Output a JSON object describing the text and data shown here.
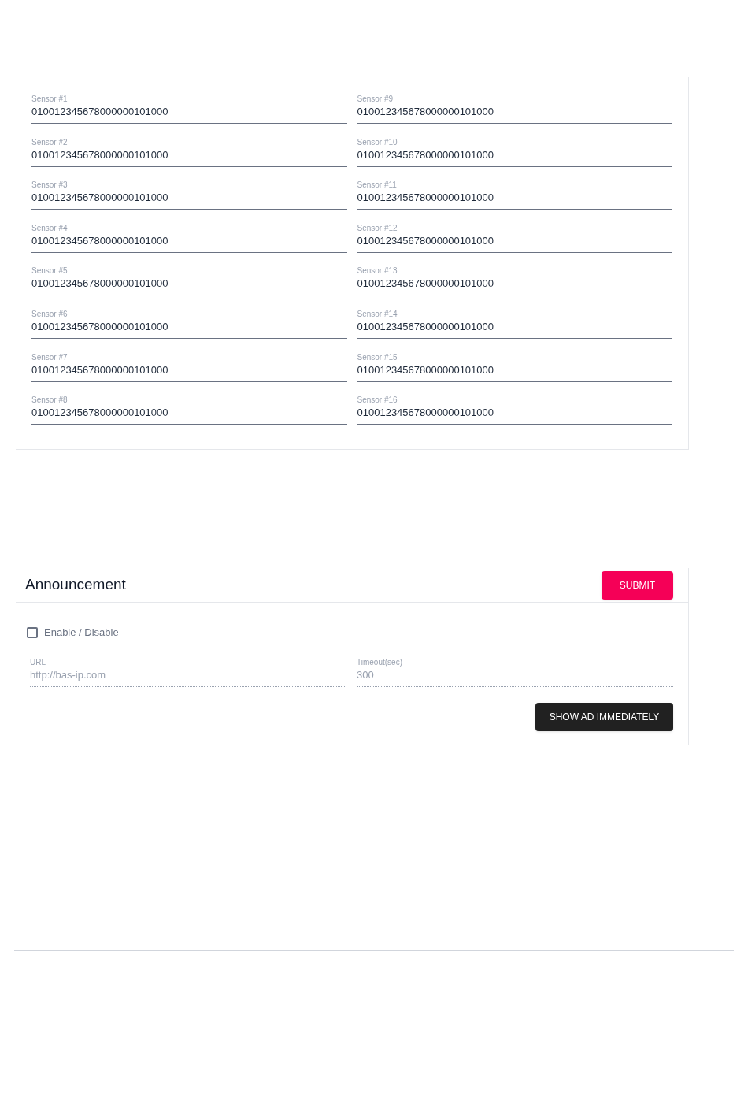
{
  "sensors": [
    {
      "label": "Sensor #1",
      "value": "010012345678000000101000"
    },
    {
      "label": "Sensor #2",
      "value": "010012345678000000101000"
    },
    {
      "label": "Sensor #3",
      "value": "010012345678000000101000"
    },
    {
      "label": "Sensor #4",
      "value": "010012345678000000101000"
    },
    {
      "label": "Sensor #5",
      "value": "010012345678000000101000"
    },
    {
      "label": "Sensor #6",
      "value": "010012345678000000101000"
    },
    {
      "label": "Sensor #7",
      "value": "010012345678000000101000"
    },
    {
      "label": "Sensor #8",
      "value": "010012345678000000101000"
    },
    {
      "label": "Sensor #9",
      "value": "010012345678000000101000"
    },
    {
      "label": "Sensor #10",
      "value": "010012345678000000101000"
    },
    {
      "label": "Sensor #11",
      "value": "010012345678000000101000"
    },
    {
      "label": "Sensor #12",
      "value": "010012345678000000101000"
    },
    {
      "label": "Sensor #13",
      "value": "010012345678000000101000"
    },
    {
      "label": "Sensor #14",
      "value": "010012345678000000101000"
    },
    {
      "label": "Sensor #15",
      "value": "010012345678000000101000"
    },
    {
      "label": "Sensor #16",
      "value": "010012345678000000101000"
    }
  ],
  "announcement": {
    "title": "Announcement",
    "submit": "SUBMIT",
    "enable": {
      "label": "Enable / Disable",
      "checked": false
    },
    "fields": [
      {
        "label": "URL",
        "value": "http://bas-ip.com",
        "disabled": true
      },
      {
        "label": "Timeout(sec)",
        "value": "300",
        "disabled": true
      }
    ],
    "action": "SHOW AD IMMEDIATELY"
  }
}
